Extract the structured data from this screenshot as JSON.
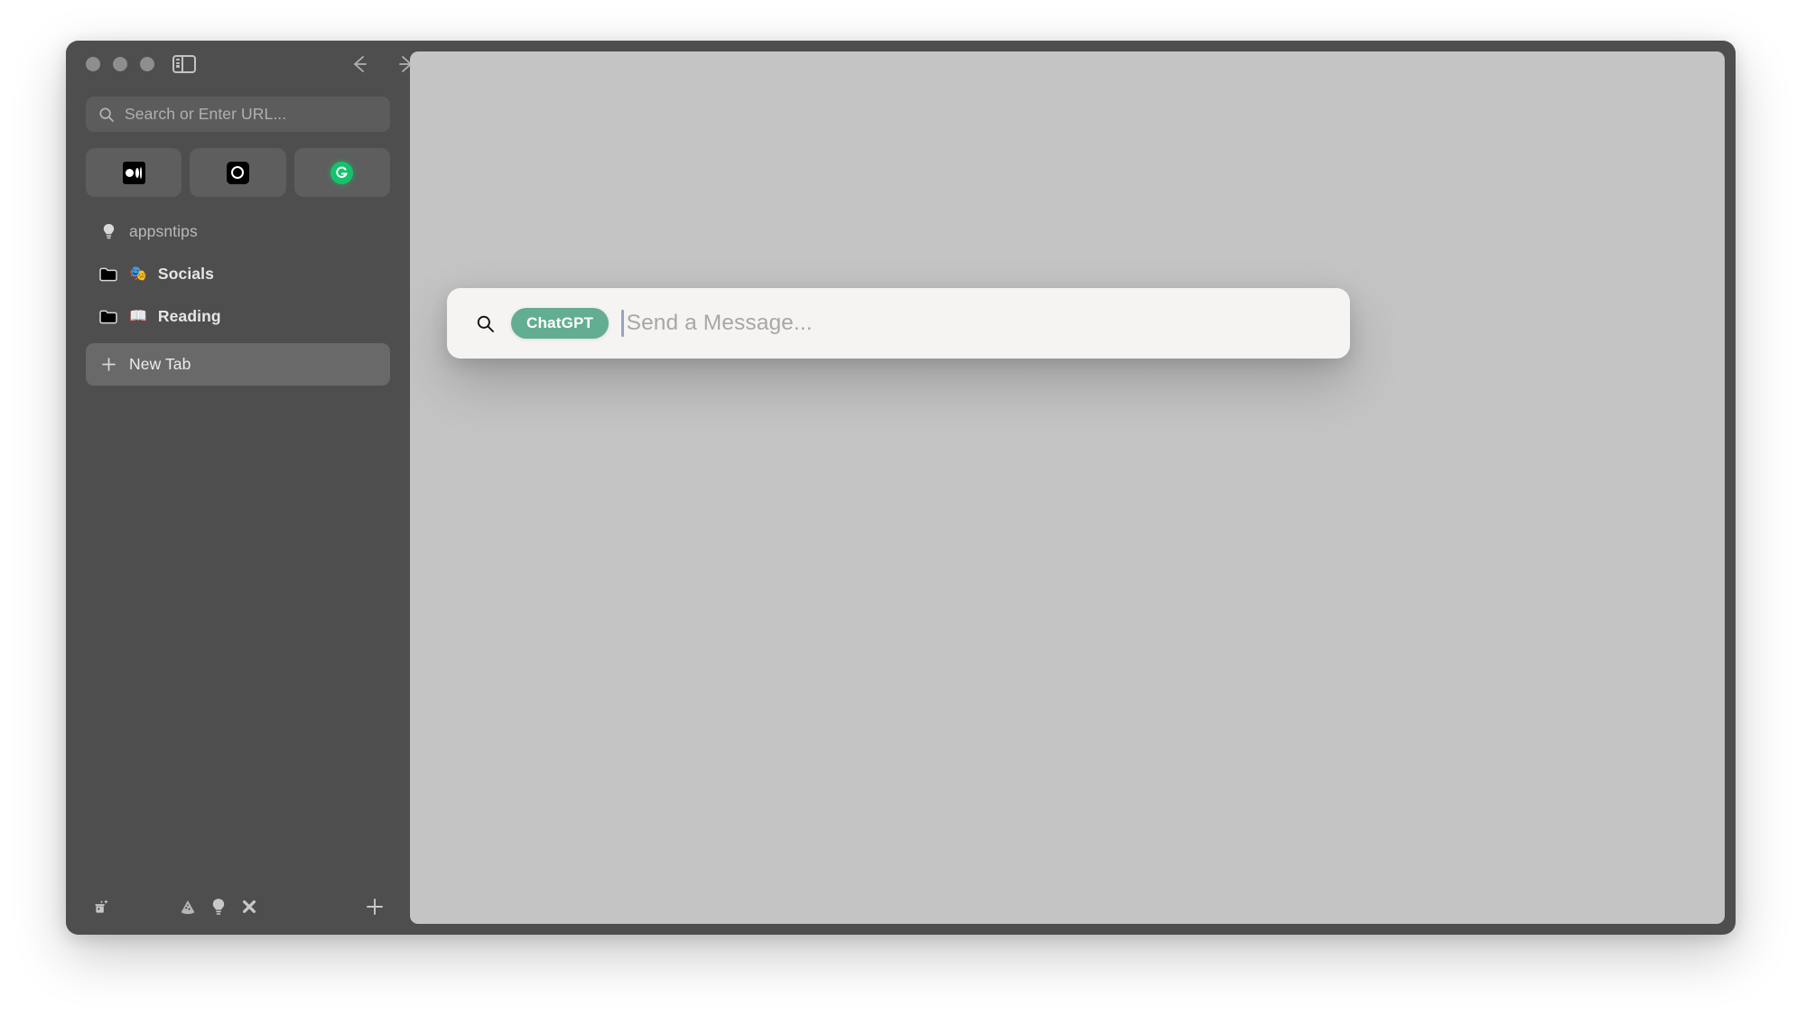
{
  "window": {
    "traffic_lights": [
      "close-button",
      "minimize-button",
      "zoom-button"
    ],
    "sidebar_toggle_icon": "sidebar-toggle-icon",
    "nav": {
      "back_icon": "arrow-left-icon",
      "forward_icon": "arrow-right-icon",
      "reload_icon": "reload-icon"
    }
  },
  "sidebar": {
    "url_bar": {
      "icon": "search-icon",
      "placeholder": "Search or Enter URL...",
      "value": ""
    },
    "pinned_tabs": [
      {
        "name": "medium",
        "icon": "medium-favicon",
        "label": ""
      },
      {
        "name": "openai",
        "icon": "ring-favicon",
        "label": ""
      },
      {
        "name": "grammarly",
        "icon": "grammarly-favicon",
        "label": ""
      }
    ],
    "items": [
      {
        "label": "appsntips",
        "icon": "lightbulb-icon",
        "emoji": "",
        "type": "space",
        "selected": false
      },
      {
        "label": "Socials",
        "icon": "folder-icon",
        "emoji": "🎭",
        "type": "folder",
        "selected": false
      },
      {
        "label": "Reading",
        "icon": "folder-icon",
        "emoji": "📖",
        "type": "folder",
        "selected": false
      },
      {
        "label": "New Tab",
        "icon": "plus-icon",
        "emoji": "",
        "type": "tab",
        "selected": true
      }
    ],
    "toolbar": [
      {
        "name": "tidy-tabs-button",
        "icon": "archive-sparkle-icon"
      },
      {
        "name": "pizza-button",
        "icon": "pizza-icon"
      },
      {
        "name": "tips-button",
        "icon": "lightbulb-icon"
      },
      {
        "name": "close-tabs-button",
        "icon": "x-icon"
      },
      {
        "name": "new-tab-button",
        "icon": "plus-icon"
      }
    ]
  },
  "command_palette": {
    "search_icon": "search-icon",
    "mode_pill": "ChatGPT",
    "placeholder": "Send a Message...",
    "value": ""
  },
  "colors": {
    "window_chrome": "#4e4e4e",
    "content_background": "#c4c4c4",
    "palette_background": "#f5f4f2",
    "pill_green": "#63ad92",
    "grammarly_green": "#15c26b",
    "selected_item": "#696969"
  }
}
